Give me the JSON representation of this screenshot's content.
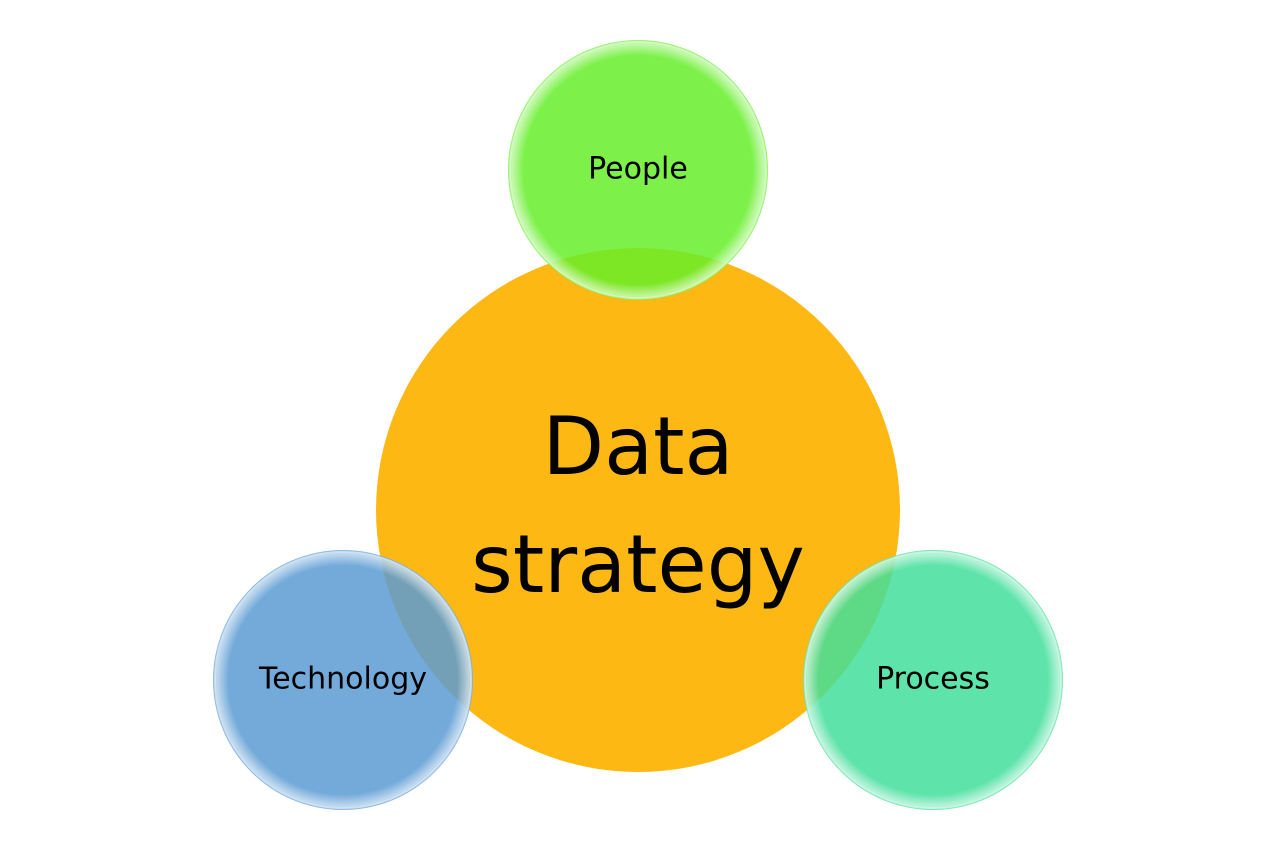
{
  "diagram": {
    "center": {
      "line1": "Data",
      "line2": "strategy",
      "color": "#FDB813"
    },
    "nodes": [
      {
        "label": "People",
        "color": "#66EE2A"
      },
      {
        "label": "Technology",
        "color": "#5A9BD3"
      },
      {
        "label": "Process",
        "color": "#42DE9B"
      }
    ]
  }
}
